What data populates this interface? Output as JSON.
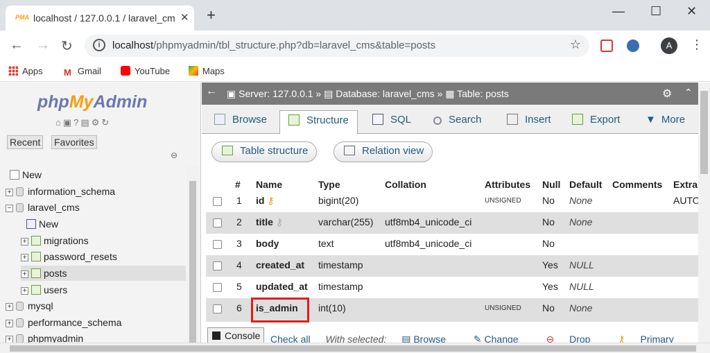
{
  "browser": {
    "tab_title": "localhost / 127.0.0.1 / laravel_cms",
    "tab_favicon": "PMA",
    "new_tab": "+",
    "url_host": "localhost",
    "url_path": "/phpmyadmin/tbl_structure.php?db=laravel_cms&table=posts",
    "avatar_letter": "A",
    "bookmarks": [
      "Apps",
      "Gmail",
      "YouTube",
      "Maps"
    ]
  },
  "left": {
    "logo_php": "php",
    "logo_my": "My",
    "logo_admin": "Admin",
    "recent": "Recent",
    "favorites": "Favorites",
    "tree": [
      {
        "label": "New",
        "kind": "new"
      },
      {
        "label": "information_schema",
        "kind": "db"
      },
      {
        "label": "laravel_cms",
        "kind": "db-open"
      },
      {
        "label": "New",
        "kind": "new-child"
      },
      {
        "label": "migrations",
        "kind": "table"
      },
      {
        "label": "password_resets",
        "kind": "table"
      },
      {
        "label": "posts",
        "kind": "table"
      },
      {
        "label": "users",
        "kind": "table"
      },
      {
        "label": "mysql",
        "kind": "db"
      },
      {
        "label": "performance_schema",
        "kind": "db"
      },
      {
        "label": "phpmyadmin",
        "kind": "db"
      }
    ]
  },
  "breadcrumb": {
    "server": "Server: 127.0.0.1",
    "database": "Database: laravel_cms",
    "table": "Table: posts"
  },
  "tabs": [
    "Browse",
    "Structure",
    "SQL",
    "Search",
    "Insert",
    "Export",
    "More"
  ],
  "subtabs": [
    "Table structure",
    "Relation view"
  ],
  "columns": [
    "#",
    "Name",
    "Type",
    "Collation",
    "Attributes",
    "Null",
    "Default",
    "Comments",
    "Extra"
  ],
  "rows": [
    {
      "num": "1",
      "name": "id",
      "key": "primary",
      "type": "bigint(20)",
      "collation": "",
      "attributes": "UNSIGNED",
      "null": "No",
      "default": "None",
      "extra": "AUTO"
    },
    {
      "num": "2",
      "name": "title",
      "key": "index",
      "type": "varchar(255)",
      "collation": "utf8mb4_unicode_ci",
      "attributes": "",
      "null": "No",
      "default": "None",
      "extra": ""
    },
    {
      "num": "3",
      "name": "body",
      "key": "",
      "type": "text",
      "collation": "utf8mb4_unicode_ci",
      "attributes": "",
      "null": "No",
      "default": "",
      "extra": ""
    },
    {
      "num": "4",
      "name": "created_at",
      "key": "",
      "type": "timestamp",
      "collation": "",
      "attributes": "",
      "null": "Yes",
      "default": "NULL",
      "extra": ""
    },
    {
      "num": "5",
      "name": "updated_at",
      "key": "",
      "type": "timestamp",
      "collation": "",
      "attributes": "",
      "null": "Yes",
      "default": "NULL",
      "extra": ""
    },
    {
      "num": "6",
      "name": "is_admin",
      "key": "",
      "type": "int(10)",
      "collation": "",
      "attributes": "UNSIGNED",
      "null": "No",
      "default": "None",
      "extra": ""
    }
  ],
  "footer": {
    "console": "Console",
    "check_all": "Check all",
    "with_selected": "With selected:",
    "browse": "Browse",
    "change": "Change",
    "drop": "Drop",
    "primary": "Primary"
  },
  "colors": {
    "link": "#235a81",
    "highlight": "#e31b1b",
    "logo_blue": "#6c78af",
    "logo_orange": "#f89c0e"
  }
}
